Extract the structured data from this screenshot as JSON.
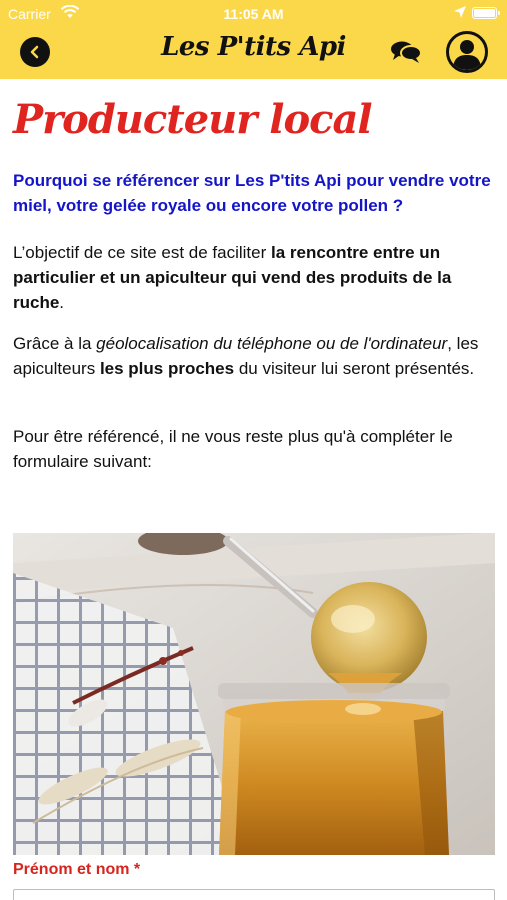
{
  "status_bar": {
    "carrier": "Carrier",
    "time": "11:05 AM"
  },
  "header": {
    "app_title": "Les P'tits Api",
    "icons": [
      "back-arrow-icon",
      "chat-bubbles-icon",
      "profile-icon"
    ],
    "background_color": "#fbd84a"
  },
  "page": {
    "title": "Producteur local",
    "title_color": "#e0241f",
    "intro_question": "Pourquoi  se  référencer sur Les P'tits Api pour vendre votre miel, votre gelée royale ou encore votre pollen  ?",
    "intro_color": "#1515c8",
    "p1": {
      "a": "L’objectif de ce site est de faciliter ",
      "b": "la rencontre entre un particulier et un apiculteur qui vend des produits de la ruche",
      "c": "."
    },
    "p2": {
      "a": "Grâce à la ",
      "b": "géolocalisation du téléphone ou de l'ordinateur",
      "c": ", les apiculteurs ",
      "d": "les plus proches",
      "e": " du visiteur lui seront présentés."
    },
    "p3": "Pour être référencé, il ne vous reste plus qu'à compléter le formulaire suivant:",
    "image": "honey-jar-photo"
  },
  "form": {
    "name_label": "Prénom et nom *",
    "name_value": "",
    "label_color": "#d7251e"
  }
}
